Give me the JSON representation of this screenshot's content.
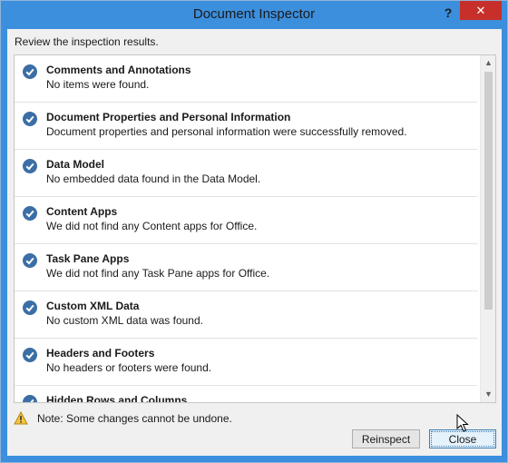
{
  "window": {
    "title": "Document Inspector",
    "help_glyph": "?",
    "close_glyph": "✕"
  },
  "instruction": "Review the inspection results.",
  "results": [
    {
      "title": "Comments and Annotations",
      "desc": "No items were found."
    },
    {
      "title": "Document Properties and Personal Information",
      "desc": "Document properties and personal information were successfully removed."
    },
    {
      "title": "Data Model",
      "desc": "No embedded data found in the Data Model."
    },
    {
      "title": "Content Apps",
      "desc": "We did not find any Content apps for Office."
    },
    {
      "title": "Task Pane Apps",
      "desc": "We did not find any Task Pane apps for Office."
    },
    {
      "title": "Custom XML Data",
      "desc": "No custom XML data was found."
    },
    {
      "title": "Headers and Footers",
      "desc": "No headers or footers were found."
    },
    {
      "title": "Hidden Rows and Columns",
      "desc": ""
    }
  ],
  "scrollbar": {
    "up_glyph": "▲",
    "down_glyph": "▼"
  },
  "note": "Note: Some changes cannot be undone.",
  "buttons": {
    "reinspect": "Reinspect",
    "close": "Close"
  },
  "icons": {
    "check": "check-circle-icon",
    "warning": "warning-icon"
  },
  "colors": {
    "titlebar": "#3b8fdd",
    "close_button": "#c7302a",
    "check_circle": "#3c6ea6"
  }
}
